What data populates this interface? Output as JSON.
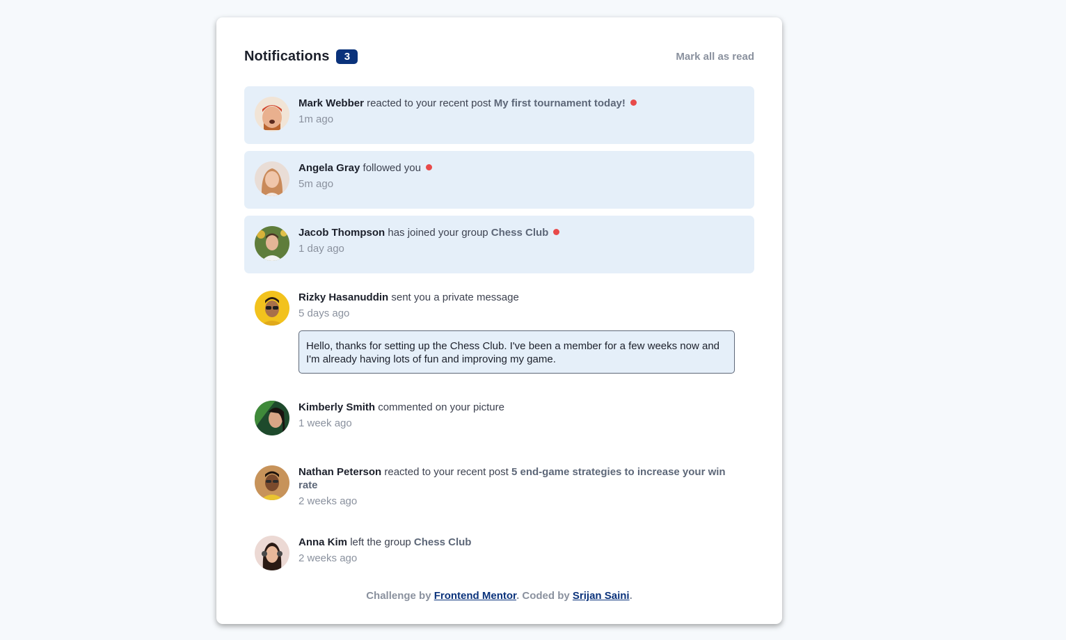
{
  "header": {
    "title": "Notifications",
    "unread_count": "3",
    "mark_all_label": "Mark all as read"
  },
  "notifications": [
    {
      "name": "Mark Webber",
      "action": "reacted to your recent post",
      "target": "My first tournament today!",
      "time": "1m ago",
      "unread": true,
      "avatar": "avatar-mark-webber"
    },
    {
      "name": "Angela Gray",
      "action": "followed you",
      "target": "",
      "time": "5m ago",
      "unread": true,
      "avatar": "avatar-angela-gray"
    },
    {
      "name": "Jacob Thompson",
      "action": "has joined your group",
      "target": "Chess Club",
      "time": "1 day ago",
      "unread": true,
      "avatar": "avatar-jacob-thompson"
    },
    {
      "name": "Rizky Hasanuddin",
      "action": "sent you a private message",
      "target": "",
      "time": "5 days ago",
      "unread": false,
      "avatar": "avatar-rizky-hasanuddin",
      "message": "Hello, thanks for setting up the Chess Club. I've been a member for a few weeks now and I'm already having lots of fun and improving my game."
    },
    {
      "name": "Kimberly Smith",
      "action": "commented on your picture",
      "target": "",
      "time": "1 week ago",
      "unread": false,
      "avatar": "avatar-kimberly-smith"
    },
    {
      "name": "Nathan Peterson",
      "action": "reacted to your recent post",
      "target": "5 end-game strategies to increase your win rate",
      "time": "2 weeks ago",
      "unread": false,
      "avatar": "avatar-nathan-peterson"
    },
    {
      "name": "Anna Kim",
      "action": "left the group",
      "target": "Chess Club",
      "time": "2 weeks ago",
      "unread": false,
      "avatar": "avatar-anna-kim"
    }
  ],
  "footer": {
    "prefix": "Challenge by",
    "link1": "Frontend Mentor",
    "middle": ". Coded by",
    "link2": "Srijan Saini",
    "suffix": "."
  },
  "colors": {
    "badge": "#0a327b",
    "unread_bg": "#e5eff9",
    "dot": "#e84a4a",
    "link": "#0a327b"
  }
}
